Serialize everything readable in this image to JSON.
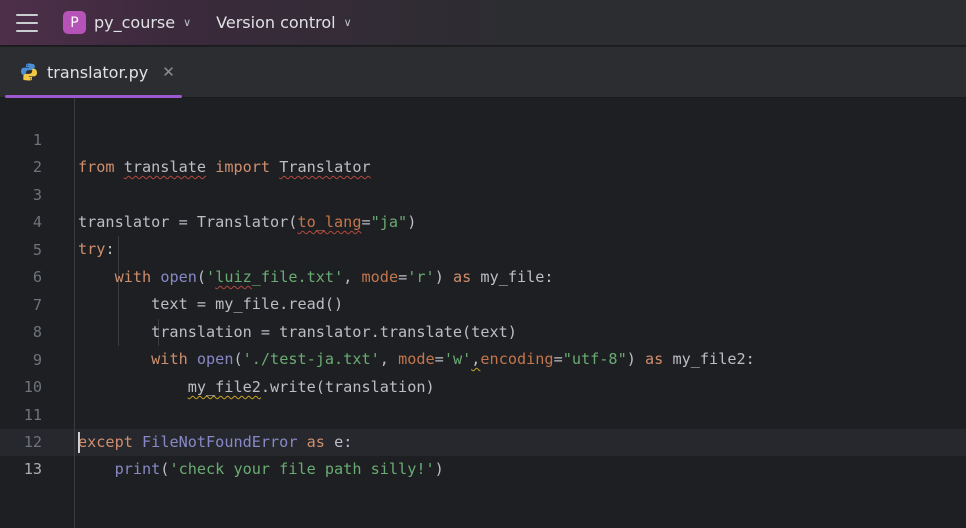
{
  "window": {
    "project_badge": "P",
    "project_name": "py_course",
    "vcs_label": "Version control"
  },
  "tabs": [
    {
      "label": "translator.py",
      "active": true,
      "icon": "python-icon"
    }
  ],
  "editor": {
    "current_line": 13,
    "lines": [
      {
        "n": "1",
        "text": "from translate import Translator"
      },
      {
        "n": "2",
        "text": ""
      },
      {
        "n": "3",
        "text": "translator = Translator(to_lang=\"ja\")"
      },
      {
        "n": "4",
        "text": "try:"
      },
      {
        "n": "5",
        "text": "    with open('luiz_file.txt', mode='r') as my_file:"
      },
      {
        "n": "6",
        "text": "        text = my_file.read()"
      },
      {
        "n": "7",
        "text": "        translation = translator.translate(text)"
      },
      {
        "n": "8",
        "text": "        with open('./test-ja.txt', mode='w',encoding=\"utf-8\") as my_file2:"
      },
      {
        "n": "9",
        "text": "            my_file2.write(translation)"
      },
      {
        "n": "10",
        "text": ""
      },
      {
        "n": "11",
        "text": "except FileNotFoundError as e:"
      },
      {
        "n": "12",
        "text": "    print('check your file path silly!')"
      },
      {
        "n": "13",
        "text": ""
      }
    ]
  },
  "colors": {
    "keyword": "#cf8e6d",
    "string": "#6aab73",
    "builtin": "#8888c6",
    "kwarg": "#c2764c",
    "accent": "#9b59d0"
  }
}
